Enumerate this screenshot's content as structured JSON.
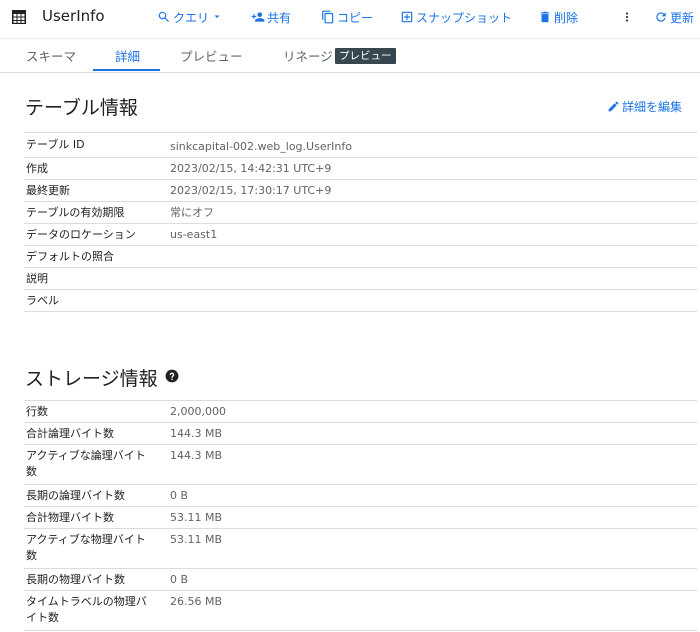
{
  "header": {
    "title": "UserInfo",
    "actions": {
      "query": "クエリ",
      "share": "共有",
      "copy": "コピー",
      "snapshot": "スナップショット",
      "delete": "削除",
      "refresh": "更新"
    }
  },
  "tabs": [
    {
      "label": "スキーマ"
    },
    {
      "label": "詳細"
    },
    {
      "label": "プレビュー"
    },
    {
      "label": "リネージ"
    }
  ],
  "tab_badge": "プレビュー",
  "table_info": {
    "title": "テーブル情報",
    "edit_label": "詳細を編集",
    "rows": [
      {
        "key": "テーブル ID",
        "value": "sinkcapital-002.web_log.UserInfo"
      },
      {
        "key": "作成",
        "value": "2023/02/15, 14:42:31 UTC+9"
      },
      {
        "key": "最終更新",
        "value": "2023/02/15, 17:30:17 UTC+9"
      },
      {
        "key": "テーブルの有効期限",
        "value": "常にオフ"
      },
      {
        "key": "データのロケーション",
        "value": "us-east1"
      },
      {
        "key": "デフォルトの照合",
        "value": ""
      },
      {
        "key": "説明",
        "value": ""
      },
      {
        "key": "ラベル",
        "value": ""
      }
    ]
  },
  "storage_info": {
    "title": "ストレージ情報",
    "rows": [
      {
        "key": "行数",
        "value": "2,000,000"
      },
      {
        "key": "合計論理バイト数",
        "value": "144.3 MB"
      },
      {
        "key": "アクティブな論理バイト数",
        "value": "144.3 MB"
      },
      {
        "key": "長期の論理バイト数",
        "value": "0 B"
      },
      {
        "key": "合計物理バイト数",
        "value": "53.11 MB"
      },
      {
        "key": "アクティブな物理バイト数",
        "value": "53.11 MB"
      },
      {
        "key": "長期の物理バイト数",
        "value": "0 B"
      },
      {
        "key": "タイムトラベルの物理バイト数",
        "value": "26.56 MB"
      }
    ]
  },
  "colors": {
    "accent": "#1a73e8",
    "badge_bg": "#37474f",
    "divider": "#dadce0"
  }
}
